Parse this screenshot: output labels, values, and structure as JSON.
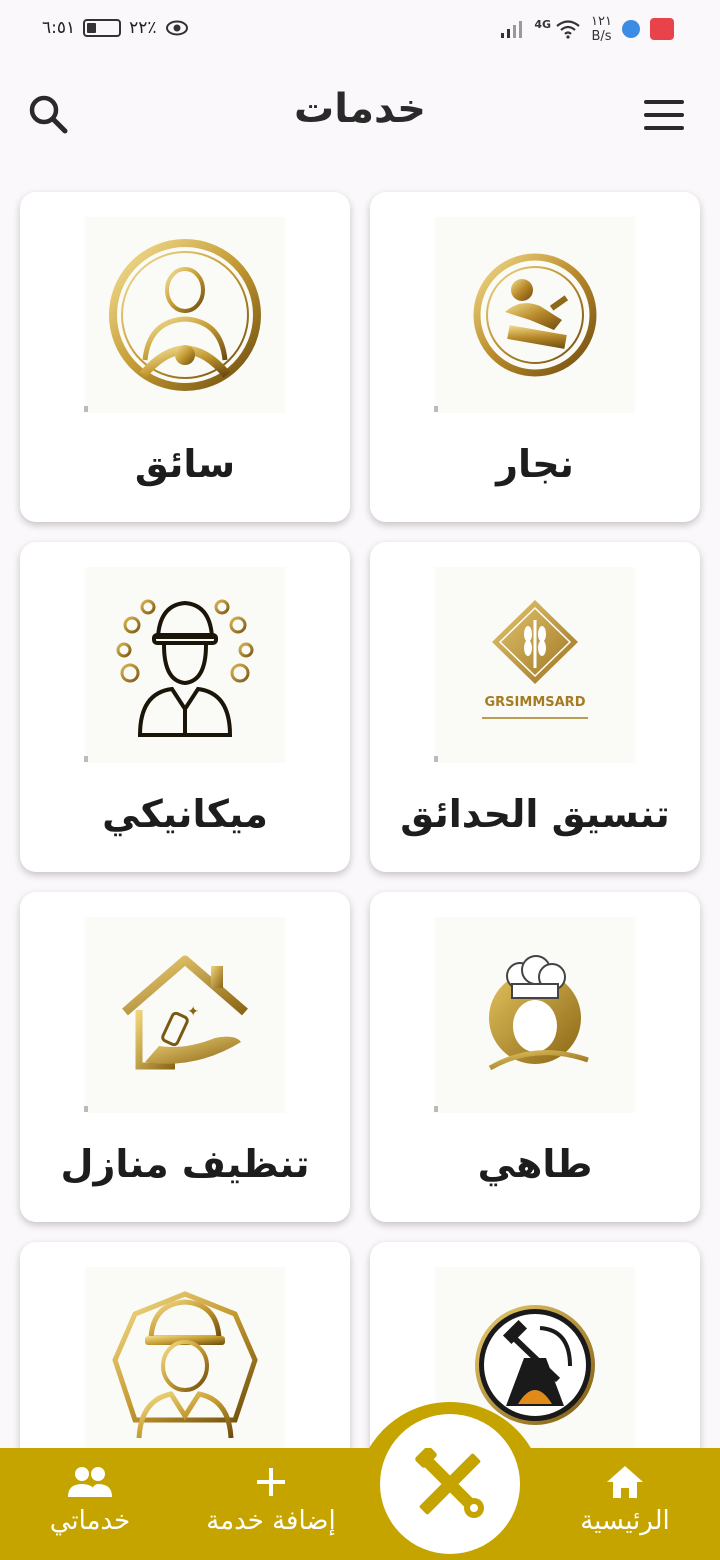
{
  "status_bar": {
    "time": "٦:٥١",
    "battery": "٢٢٪",
    "net_speed_value": "١٢١",
    "net_speed_unit": "B/s",
    "network": "4G"
  },
  "app_bar": {
    "title": "خدمات",
    "search_icon": "search-icon",
    "menu_icon": "hamburger-menu-icon"
  },
  "services": [
    {
      "label": "نجار",
      "icon": "carpenter-icon"
    },
    {
      "label": "سائق",
      "icon": "driver-icon"
    },
    {
      "label": "تنسيق الحدائق",
      "icon": "garden-landscaping-icon",
      "logo_text": "GRSIMMSARD"
    },
    {
      "label": "ميكانيكي",
      "icon": "mechanic-icon"
    },
    {
      "label": "طاهي",
      "icon": "chef-icon"
    },
    {
      "label": "تنظيف منازل",
      "icon": "house-cleaning-icon"
    },
    {
      "label": "",
      "icon": "blacksmith-icon"
    },
    {
      "label": "",
      "icon": "engineer-icon"
    }
  ],
  "bottom_nav": {
    "home": "الرئيسية",
    "add_service": "إضافة خدمة",
    "my_services": "خدماتي",
    "center_icon": "tools-icon"
  },
  "colors": {
    "accent_gold": "#c6a400",
    "background": "#fbf8fb",
    "card": "#ffffff"
  }
}
